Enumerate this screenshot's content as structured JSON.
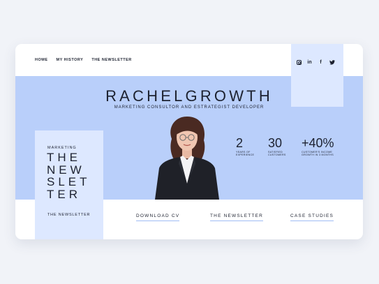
{
  "nav": {
    "items": [
      "HOME",
      "MY HISTORY",
      "THE NEWSLETTER"
    ]
  },
  "social": {
    "icons": [
      "instagram-icon",
      "linkedin-icon",
      "facebook-icon",
      "twitter-icon"
    ],
    "linkedin_glyph": "in",
    "facebook_glyph": "f"
  },
  "hero": {
    "title": "RACHELGROWTH",
    "subtitle": "MARKETING CONSULTOR AND ESTRATEGIST DEVELOPER"
  },
  "newsletter_panel": {
    "label": "MARKETING",
    "lines": [
      "THE",
      "NEW",
      "SLET",
      "TER"
    ],
    "sub": "THE NEWSLETTER"
  },
  "stats": [
    {
      "value": "2",
      "label_lines": [
        "YEARS OF",
        "EXPERIENCE"
      ]
    },
    {
      "value": "30",
      "label_lines": [
        "SATISFIED",
        "CUSTOMERS"
      ]
    },
    {
      "value": "+40%",
      "label_lines": [
        "CUSTOMER'S INCOME",
        "GROWTH IN 3 MONTHS"
      ]
    }
  ],
  "buttons": {
    "download": "DOWNLOAD CV",
    "newsletter": "THE NEWSLETTER",
    "cases": "CASE STUDIES"
  },
  "colors": {
    "band": "#b9cffa",
    "panel": "#dde8ff",
    "text": "#1d2230",
    "page": "#f1f3f8"
  }
}
